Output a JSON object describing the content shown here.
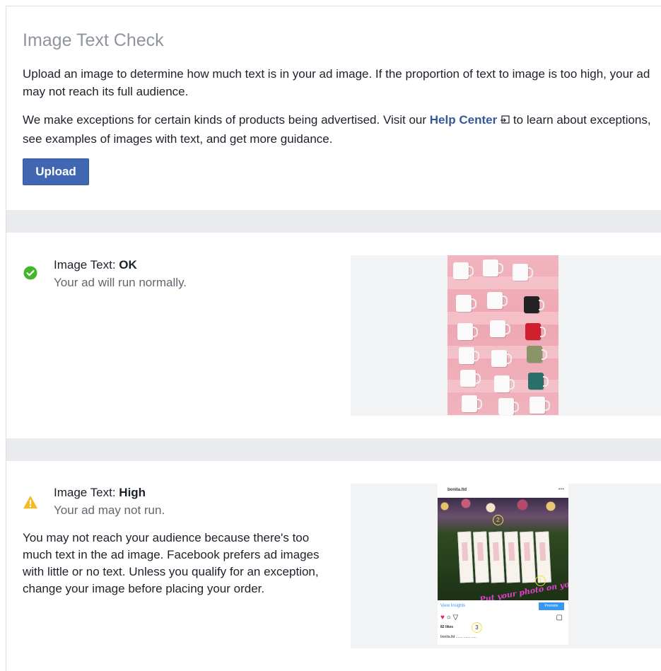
{
  "header": {
    "title": "Image Text Check",
    "description": "Upload an image to determine how much text is in your ad image. If the proportion of text to image is too high, your ad may not reach its full audience.",
    "exceptions_before": "We make exceptions for certain kinds of products being advertised. Visit our ",
    "help_center_link": "Help Center",
    "exceptions_after": " to learn about exceptions, see examples of images with text, and get more guidance.",
    "upload_label": "Upload"
  },
  "results": [
    {
      "label_prefix": "Image Text: ",
      "rating": "OK",
      "subtitle": "Your ad will run normally.",
      "status_icon": "check-circle-icon",
      "status_color": "#42b72a"
    },
    {
      "label_prefix": "Image Text: ",
      "rating": "High",
      "subtitle": "Your ad may not run.",
      "details": "You may not reach your audience because there's too much text in the ad image. Facebook prefers ad images with little or no text. Unless you qualify for an exception, change your image before placing your order.",
      "status_icon": "warning-icon",
      "status_color": "#f7b928"
    }
  ],
  "instagram_preview": {
    "account": "bonita.ltd",
    "view_insights": "View Insights",
    "promote": "Promote",
    "likes": "82 likes",
    "overlay_text": "Put your photo on your bookmark",
    "markers": [
      "1",
      "2",
      "3"
    ]
  },
  "colors": {
    "link": "#365899",
    "button": "#4267b2",
    "separator": "#e9ebee",
    "title": "#90949c"
  }
}
